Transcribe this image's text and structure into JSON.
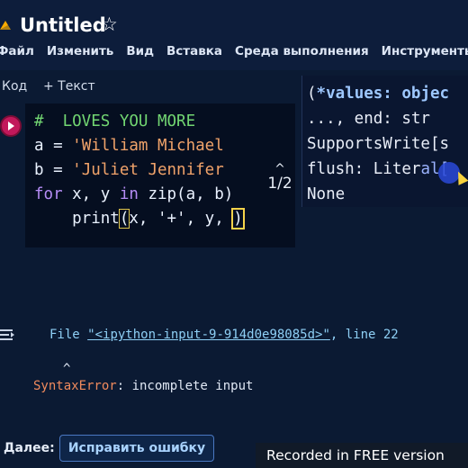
{
  "app": {
    "title": "Untitled",
    "star_icon": "star-icon",
    "logo_icon": "colab-logo-icon"
  },
  "menu": [
    "Файл",
    "Изменить",
    "Вид",
    "Вставка",
    "Среда выполнения",
    "Инструменты"
  ],
  "toolbar": {
    "code_label": "Код",
    "text_label": "+ Текст"
  },
  "cell": {
    "run_icon": "run-cell-icon",
    "lines": {
      "comment": "#  LOVES YOU MORE",
      "line_a_prefix": "a = ",
      "line_a_str": "'William Michael",
      "line_b_prefix": "b = ",
      "line_b_str": "'Juliet Jennifer",
      "line_for_kw": "for",
      "line_for_mid": " x, y ",
      "line_for_in": "in",
      "line_for_rest": " zip(a, b)",
      "line_print_indent": "    print",
      "line_print_paren": "(",
      "line_print_args": "x, '+', y, ",
      "line_print_cursor": ")"
    }
  },
  "signature": {
    "pager": "1/2",
    "line1_open": "(",
    "line1_kw": "*values: objec",
    "line2": "..., end: str ",
    "line3": "SupportsWrite[s",
    "line4_prefix": "flush: Liter",
    "line4_hl": "al[",
    "line5": "None"
  },
  "output": {
    "file_prefix": "File ",
    "file_link": "\"<ipython-input-9-914d0e98085d>\"",
    "file_suffix": ", line 22",
    "caret": "^",
    "error_name": "SyntaxError",
    "error_msg": ": incomplete input"
  },
  "footer": {
    "next_label": "Далее:",
    "fix_button": "Исправить ошибку",
    "watermark": "Recorded in FREE version"
  },
  "colors": {
    "background": "#0b1a33",
    "run_button": "#c2185b",
    "string": "#f1a36a",
    "keyword": "#b58cf5",
    "comment": "#72d672",
    "error": "#f08a5d",
    "link": "#8ecff5"
  }
}
